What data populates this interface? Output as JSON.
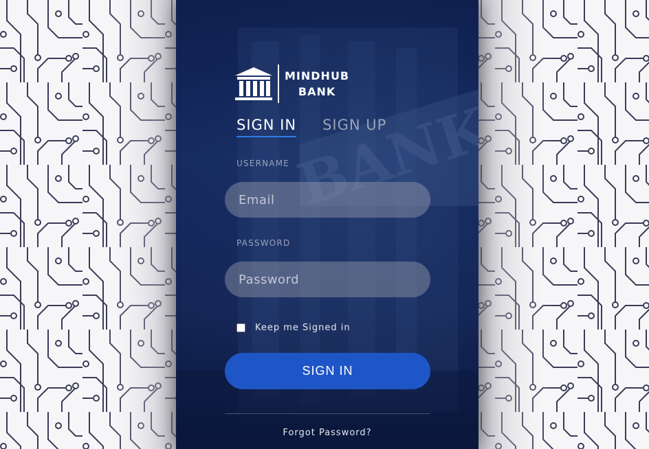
{
  "brand": {
    "line1": "MINDHUB",
    "line2": "BANK",
    "logo_icon": "bank-building-icon"
  },
  "tabs": [
    {
      "label": "SIGN IN",
      "active": true
    },
    {
      "label": "SIGN UP",
      "active": false
    }
  ],
  "form": {
    "username_label": "USERNAME",
    "username_placeholder": "Email",
    "password_label": "PASSWORD",
    "password_placeholder": "Password",
    "keep_signed_in_label": "Keep me Signed in",
    "keep_signed_in_checked": false,
    "submit_label": "SIGN IN",
    "forgot_label": "Forgot Password?"
  },
  "colors": {
    "accent": "#1f56c7",
    "tab_underline": "#2f7be6",
    "panel": "#14285e",
    "circuit": "#3a3a58"
  }
}
